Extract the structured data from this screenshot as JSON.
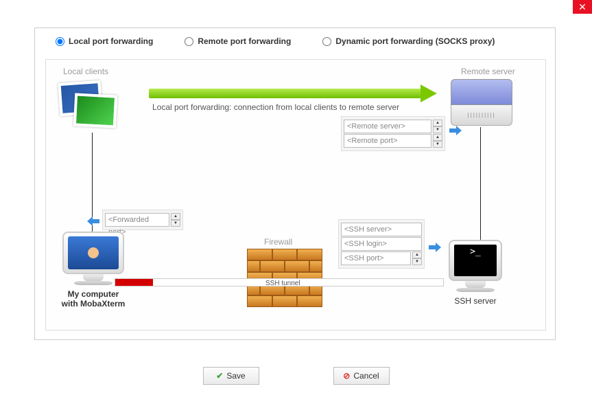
{
  "radios": {
    "local": "Local port forwarding",
    "remote": "Remote port forwarding",
    "dynamic": "Dynamic port forwarding (SOCKS proxy)"
  },
  "labels": {
    "local_clients": "Local clients",
    "remote_server": "Remote server",
    "arrow_caption": "Local port forwarding: connection from local clients to remote server",
    "firewall": "Firewall",
    "ssh_tunnel": "SSH tunnel",
    "my_computer_l1": "My computer",
    "my_computer_l2": "with MobaXterm",
    "ssh_server": "SSH server"
  },
  "fields": {
    "remote_server": "<Remote server>",
    "remote_port": "<Remote port>",
    "forwarded_port": "<Forwarded port>",
    "ssh_server": "<SSH server>",
    "ssh_login": "<SSH login>",
    "ssh_port": "<SSH port>"
  },
  "buttons": {
    "save": "Save",
    "cancel": "Cancel"
  },
  "term_prompt": ">_"
}
